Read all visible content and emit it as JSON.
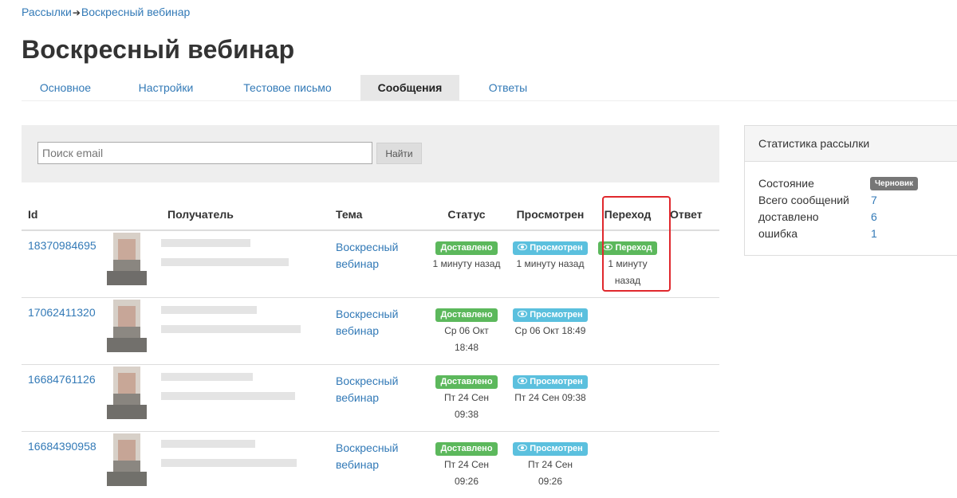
{
  "breadcrumb": {
    "parent": "Рассылки",
    "separator": "➔",
    "current": "Воскресный вебинар"
  },
  "page_title": "Воскресный вебинар",
  "tabs": [
    {
      "label": "Основное",
      "active": false
    },
    {
      "label": "Настройки",
      "active": false
    },
    {
      "label": "Тестовое письмо",
      "active": false
    },
    {
      "label": "Сообщения",
      "active": true
    },
    {
      "label": "Ответы",
      "active": false
    }
  ],
  "search": {
    "placeholder": "Поиск email",
    "button_label": "Найти"
  },
  "table": {
    "headers": {
      "id": "Id",
      "recipient": "Получатель",
      "topic": "Тема",
      "status": "Статус",
      "viewed": "Просмотрен",
      "click": "Переход",
      "reply": "Ответ"
    },
    "rows": [
      {
        "id": "18370984695",
        "topic": "Воскресный вебинар",
        "status_badge": "Доставлено",
        "status_time": "1 минуту назад",
        "viewed_badge": "Просмотрен",
        "viewed_time": "1 минуту назад",
        "click_badge": "Переход",
        "click_time": "1 минуту назад",
        "reply": ""
      },
      {
        "id": "17062411320",
        "topic": "Воскресный вебинар",
        "status_badge": "Доставлено",
        "status_time": "Ср 06 Окт 18:48",
        "viewed_badge": "Просмотрен",
        "viewed_time": "Ср 06 Окт 18:49",
        "click_badge": "",
        "click_time": "",
        "reply": ""
      },
      {
        "id": "16684761126",
        "topic": "Воскресный вебинар",
        "status_badge": "Доставлено",
        "status_time": "Пт 24 Сен 09:38",
        "viewed_badge": "Просмотрен",
        "viewed_time": "Пт 24 Сен 09:38",
        "click_badge": "",
        "click_time": "",
        "reply": ""
      },
      {
        "id": "16684390958",
        "topic": "Воскресный вебинар",
        "status_badge": "Доставлено",
        "status_time": "Пт 24 Сен 09:26",
        "viewed_badge": "Просмотрен",
        "viewed_time": "Пт 24 Сен 09:26",
        "click_badge": "",
        "click_time": "",
        "reply": ""
      }
    ]
  },
  "stats": {
    "title": "Статистика рассылки",
    "state_label": "Состояние",
    "state_badge": "Черновик",
    "total_label": "Всего сообщений",
    "total_value": "7",
    "delivered_label": "доставлено",
    "delivered_value": "6",
    "error_label": "ошибка",
    "error_value": "1"
  },
  "colors": {
    "link": "#337ab7",
    "delivered": "#5cb85c",
    "viewed": "#5bc0de",
    "draft": "#777777",
    "highlight": "#e0282d"
  },
  "icons": {
    "view": "eye-icon"
  }
}
